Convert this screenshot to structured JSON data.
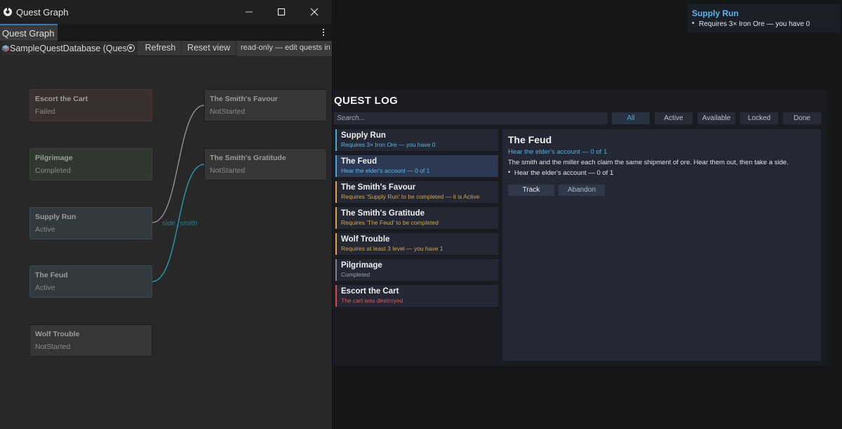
{
  "editor": {
    "window_title": "Quest Graph",
    "tab_label": "Quest Graph",
    "toolbar": {
      "database_field": "SampleQuestDatabase (Ques",
      "refresh_label": "Refresh",
      "reset_view_label": "Reset view",
      "readonly_note": "read-only — edit quests in th"
    },
    "nodes": {
      "escort": {
        "title": "Escort the Cart",
        "status": "Failed"
      },
      "pilgrimage": {
        "title": "Pilgrimage",
        "status": "Completed"
      },
      "supply": {
        "title": "Supply Run",
        "status": "Active"
      },
      "feud": {
        "title": "The Feud",
        "status": "Active"
      },
      "wolf": {
        "title": "Wolf Trouble",
        "status": "NotStarted"
      },
      "favour": {
        "title": "The Smith's Favour",
        "status": "NotStarted"
      },
      "gratitude": {
        "title": "The Smith's Gratitude",
        "status": "NotStarted"
      }
    },
    "edge_label": "side_smith",
    "icons": [
      "unity-logo-icon",
      "minimize-icon",
      "maximize-icon",
      "close-icon",
      "kebab-menu-icon",
      "scriptable-object-icon",
      "object-picker-icon"
    ]
  },
  "tracker": {
    "title": "Supply Run",
    "requirement": "Requires 3× Iron Ore — you have 0"
  },
  "quest_log": {
    "title": "QUEST LOG",
    "search_placeholder": "Search...",
    "filters": {
      "all": "All",
      "active": "Active",
      "available": "Available",
      "locked": "Locked",
      "done": "Done"
    },
    "selected_filter": "All",
    "quests": [
      {
        "name": "Supply Run",
        "sub": "Requires 3× Iron Ore — you have 0",
        "state": "active"
      },
      {
        "name": "The Feud",
        "sub": "Hear the elder's account — 0 of 1",
        "state": "active"
      },
      {
        "name": "The Smith's Favour",
        "sub": "Requires 'Supply Run' to be completed — it is Active",
        "state": "available"
      },
      {
        "name": "The Smith's Gratitude",
        "sub": "Requires 'The Feud' to be completed",
        "state": "available"
      },
      {
        "name": "Wolf Trouble",
        "sub": "Requires at least 3 level — you have 1",
        "state": "available"
      },
      {
        "name": "Pilgrimage",
        "sub": "Completed",
        "state": "done"
      },
      {
        "name": "Escort the Cart",
        "sub": "The cart was destroyed",
        "state": "failed"
      }
    ],
    "detail": {
      "title": "The Feud",
      "progress": "Hear the elder's account — 0 of 1",
      "description": "The smith and the miller each claim the same shipment of ore. Hear them out, then take a side.",
      "objective": "Hear the elder's account — 0 of 1",
      "track_label": "Track",
      "abandon_label": "Abandon"
    }
  },
  "colors": {
    "accent": "#3fb6e0",
    "available": "#d9a640",
    "failed": "#e05555",
    "edge_active": "#1fa8c0",
    "edge_inactive": "#9a9a9a"
  }
}
